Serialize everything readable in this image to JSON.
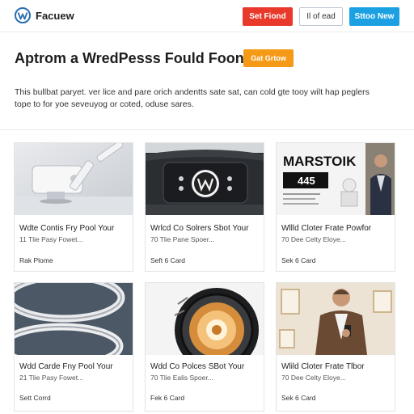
{
  "header": {
    "brand_name": "Facuew",
    "buttons": [
      {
        "label": "Set Fiond",
        "color": "#e8392a"
      },
      {
        "label": "Il of ead",
        "color": "#ffffff"
      },
      {
        "label": "Sttoo New",
        "color": "#1ba1e2"
      }
    ]
  },
  "hero": {
    "title": "Aptrom a WredPesss Fould Foon?",
    "cta_label": "Gat Grtow",
    "cta_color": "#f59a16",
    "description": "This bullbat paryet. ver lice and pare orich andentts sate sat, can cold gte tooy wilt hap peglers tope to for yoe seveuyog or coted, oduse sares."
  },
  "cards": [
    {
      "title": "Wdte Contis Fry Pool Your",
      "subtitle": "11 Tlie Pasy Fowet...",
      "link": "Rak Plome",
      "image": "robot-arm"
    },
    {
      "title": "Wrlcd Co Solrers Sbot Your",
      "subtitle": "70 Tlie Pane Spoer...",
      "link": "Seft 6 Card",
      "image": "car-dashboard-wp"
    },
    {
      "title": "Wllld Cloter Frate Powfor",
      "subtitle": "70 Dee Celty Eloye...",
      "link": "Sek 6 Card",
      "image": "marstoik-poster",
      "poster_title": "MARSTOIK",
      "poster_number": "445"
    },
    {
      "title": "Wdd Carde Fny Pool Your",
      "subtitle": "21 Tlie Pasy Fowet...",
      "link": "Sett Corrd",
      "image": "metal-rings"
    },
    {
      "title": "Wdd Co Polces SBot Your",
      "subtitle": "70 Tlie Ealis Spoer...",
      "link": "Fek 6 Card",
      "image": "camera-lens"
    },
    {
      "title": "Wlild Cloter Frate Tlbor",
      "subtitle": "70 Dee Celty Eloye...",
      "link": "Sek 6 Card",
      "image": "man-phone"
    }
  ]
}
